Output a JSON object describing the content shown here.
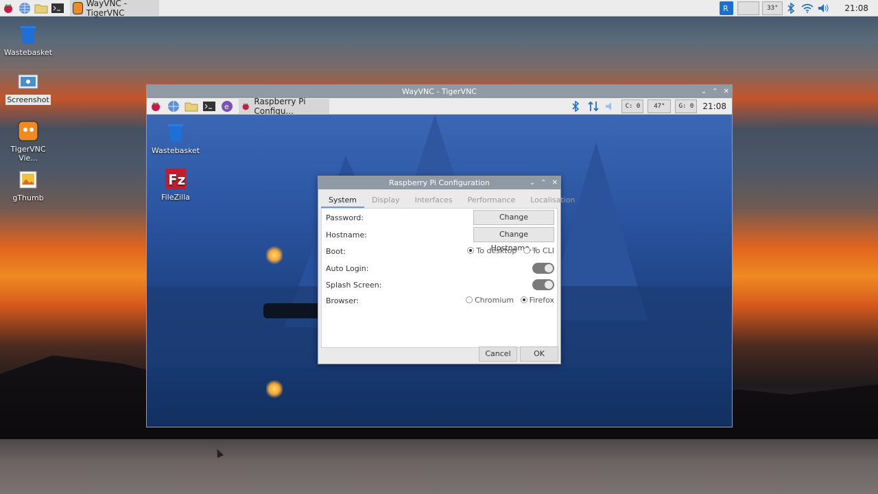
{
  "top_panel": {
    "task_label": "WayVNC - TigerVNC",
    "temp": "33°",
    "clock": "21:08"
  },
  "desktop_icons": [
    {
      "label": "Wastebasket"
    },
    {
      "label": "Screenshot"
    },
    {
      "label": "TigerVNC Vie..."
    },
    {
      "label": "gThumb"
    }
  ],
  "vnc_window": {
    "title": "WayVNC - TigerVNC",
    "task_label": "Raspberry Pi Configu...",
    "cpu": "C: 0",
    "temp": "47°",
    "gpu": "G: 0",
    "clock": "21:08",
    "desktop_icons": [
      {
        "label": "Wastebasket"
      },
      {
        "label": "FileZilla"
      }
    ]
  },
  "dialog": {
    "title": "Raspberry Pi Configuration",
    "tabs": [
      "System",
      "Display",
      "Interfaces",
      "Performance",
      "Localisation"
    ],
    "active_tab": "System",
    "rows": {
      "password_label": "Password:",
      "password_button": "Change Password...",
      "hostname_label": "Hostname:",
      "hostname_button": "Change Hostname...",
      "boot_label": "Boot:",
      "boot_opt1": "To desktop",
      "boot_opt2": "To CLI",
      "autologin_label": "Auto Login:",
      "splash_label": "Splash Screen:",
      "browser_label": "Browser:",
      "browser_opt1": "Chromium",
      "browser_opt2": "Firefox"
    },
    "cancel": "Cancel",
    "ok": "OK"
  },
  "colors": {
    "titlebar": "#8f9aa5",
    "accent": "#6a9bd8"
  }
}
